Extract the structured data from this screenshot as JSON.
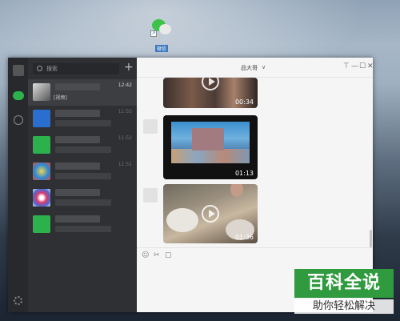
{
  "desktop": {
    "wechat_shortcut_label": "微信"
  },
  "sidebar": {
    "icons": [
      "avatar-icon",
      "chat-icon",
      "contacts-icon",
      "settings-icon"
    ]
  },
  "chat_list": {
    "search_placeholder": "搜索",
    "add_label": "+",
    "items": [
      {
        "time": "12:42",
        "preview": "[视频]"
      },
      {
        "time": "11:55",
        "preview": ""
      },
      {
        "time": "11:52",
        "preview": ""
      },
      {
        "time": "11:51",
        "preview": ""
      },
      {
        "time": "",
        "preview": ""
      },
      {
        "time": "",
        "preview": ""
      }
    ]
  },
  "chat": {
    "title": "品大哥",
    "title_chevron": "∨",
    "window_controls": {
      "pin": "⊤",
      "minimize": "—",
      "maximize": "☐",
      "close": "✕"
    },
    "videos": [
      {
        "duration": "00:34"
      },
      {
        "duration": "01:13"
      },
      {
        "duration": "01:36"
      }
    ],
    "toolbar": {
      "emoji": "☺",
      "screenshot": "✂",
      "file": "▢"
    }
  },
  "watermark": {
    "title": "百科全说",
    "subtitle": "助你轻松解决"
  },
  "colors": {
    "sidebar_bg": "#28292c",
    "list_bg": "#2e3033",
    "chat_bg": "#f5f5f5",
    "accent_green": "#2bb24c",
    "watermark_green": "#2f9a3e"
  }
}
